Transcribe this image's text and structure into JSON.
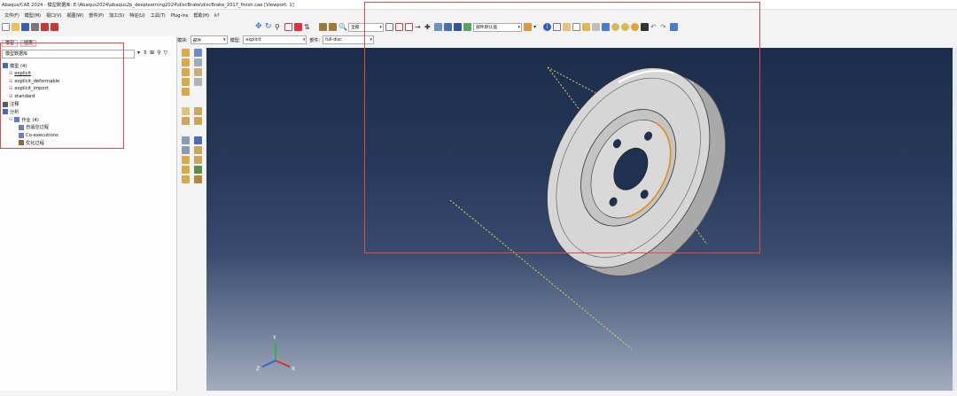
{
  "window": {
    "title": "Abaqus/CAE 2024 - 模型数据库: E:\\Abaqus2024\\abaqus2p_deeplearning2024\\discBrake\\discBrake_2017_finish.cae [Viewport: 1]"
  },
  "menu": {
    "items": [
      "文件(F)",
      "模型(M)",
      "视口(V)",
      "视图(W)",
      "部件(P)",
      "加工(S)",
      "特征(U)",
      "工具(T)",
      "Plug-ins",
      "帮助(H)",
      "k?"
    ]
  },
  "toolbar": {
    "view_select": "全部",
    "render_select": "部件默认值"
  },
  "context": {
    "module_label": "模块:",
    "module_value": "部件",
    "model_label": "模型:",
    "model_value": "explicit",
    "part_label": "部件:",
    "part_value": "full-disc"
  },
  "tabs": {
    "model": "模型",
    "results": "结果"
  },
  "tree": {
    "filter": "模型数据库",
    "items": [
      {
        "label": "模型 (4)",
        "indent": 0
      },
      {
        "label": "explicit",
        "indent": 1,
        "underline": true
      },
      {
        "label": "explicit_deformable",
        "indent": 1
      },
      {
        "label": "explicit_import",
        "indent": 1
      },
      {
        "label": "standard",
        "indent": 1
      },
      {
        "label": "注释",
        "indent": 0
      },
      {
        "label": "分析",
        "indent": 0
      },
      {
        "label": "作业 (4)",
        "indent": 1
      },
      {
        "label": "自适应过程",
        "indent": 2
      },
      {
        "label": "Co-executions",
        "indent": 2
      },
      {
        "label": "优化过程",
        "indent": 2
      }
    ]
  },
  "triad": {
    "x": "X",
    "y": "Y",
    "z": "Z"
  },
  "colors": {
    "viewport_top": "#1c2d4a",
    "viewport_bottom": "#a2adbe",
    "highlight_box": "#e04a4a",
    "disc_face": "#c9c9c9",
    "edge_highlight": "#e58a1f",
    "datum_line": "#d8d36a"
  }
}
